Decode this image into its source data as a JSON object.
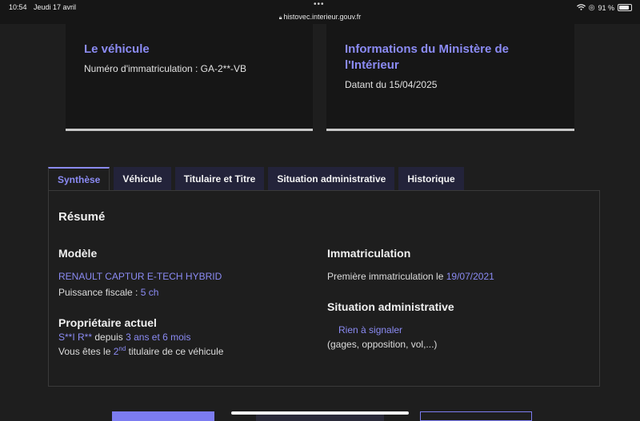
{
  "status_bar": {
    "time": "10:54",
    "date": "Jeudi 17 avril",
    "url": "histovec.interieur.gouv.fr",
    "battery": "91 %"
  },
  "cards": {
    "vehicle": {
      "title": "Le véhicule",
      "plate_text": "Numéro d'immatriculation : GA-2**-VB"
    },
    "ministry": {
      "title": "Informations du Ministère de l'Intérieur",
      "date_text": "Datant du 15/04/2025"
    }
  },
  "tabs": [
    {
      "label": "Synthèse",
      "active": true
    },
    {
      "label": "Véhicule"
    },
    {
      "label": "Titulaire et Titre"
    },
    {
      "label": "Situation administrative"
    },
    {
      "label": "Historique"
    }
  ],
  "summary": {
    "title": "Résumé",
    "model": {
      "heading": "Modèle",
      "name": "RENAULT CAPTUR E-TECH HYBRID",
      "power_label": "Puissance fiscale :",
      "power_value": "5 ch"
    },
    "owner": {
      "heading": "Propriétaire actuel",
      "name": "S**I R**",
      "since_label": "depuis",
      "duration": "3 ans et 6 mois",
      "rank_prefix": "Vous êtes le",
      "rank_number": "2",
      "rank_suffix": "nd",
      "rank_rest": "titulaire de ce véhicule"
    },
    "registration": {
      "heading": "Immatriculation",
      "first_label": "Première immatriculation le",
      "first_date": "19/07/2021"
    },
    "admin": {
      "heading": "Situation administrative",
      "status": "Rien à signaler",
      "details": "(gages, opposition, vol,...)"
    }
  },
  "colors": {
    "accent": "#8b8bf4",
    "background": "#1e1e1e",
    "card": "#161616",
    "tab": "#23233a"
  }
}
